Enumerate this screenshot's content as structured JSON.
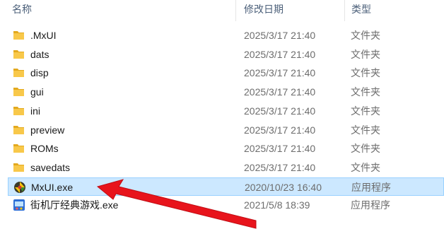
{
  "header": {
    "name": "名称",
    "date": "修改日期",
    "type": "类型"
  },
  "rows": [
    {
      "name": ".MxUI",
      "date": "2025/3/17 21:40",
      "type": "文件夹",
      "icon": "folder-icon"
    },
    {
      "name": "dats",
      "date": "2025/3/17 21:40",
      "type": "文件夹",
      "icon": "folder-icon"
    },
    {
      "name": "disp",
      "date": "2025/3/17 21:40",
      "type": "文件夹",
      "icon": "folder-icon"
    },
    {
      "name": "gui",
      "date": "2025/3/17 21:40",
      "type": "文件夹",
      "icon": "folder-icon"
    },
    {
      "name": "ini",
      "date": "2025/3/17 21:40",
      "type": "文件夹",
      "icon": "folder-icon"
    },
    {
      "name": "preview",
      "date": "2025/3/17 21:40",
      "type": "文件夹",
      "icon": "folder-icon"
    },
    {
      "name": "ROMs",
      "date": "2025/3/17 21:40",
      "type": "文件夹",
      "icon": "folder-icon"
    },
    {
      "name": "savedats",
      "date": "2025/3/17 21:40",
      "type": "文件夹",
      "icon": "folder-icon"
    },
    {
      "name": "MxUI.exe",
      "date": "2020/10/23 16:40",
      "type": "应用程序",
      "icon": "mxui-app-icon",
      "selected": true
    },
    {
      "name": "街机厅经典游戏.exe",
      "date": "2021/5/8 18:39",
      "type": "应用程序",
      "icon": "arcade-app-icon"
    }
  ],
  "colors": {
    "selection_bg": "#cce8ff",
    "selection_border": "#99d1ff",
    "folder": "#f8c84a",
    "arrow": "#e8141c"
  }
}
